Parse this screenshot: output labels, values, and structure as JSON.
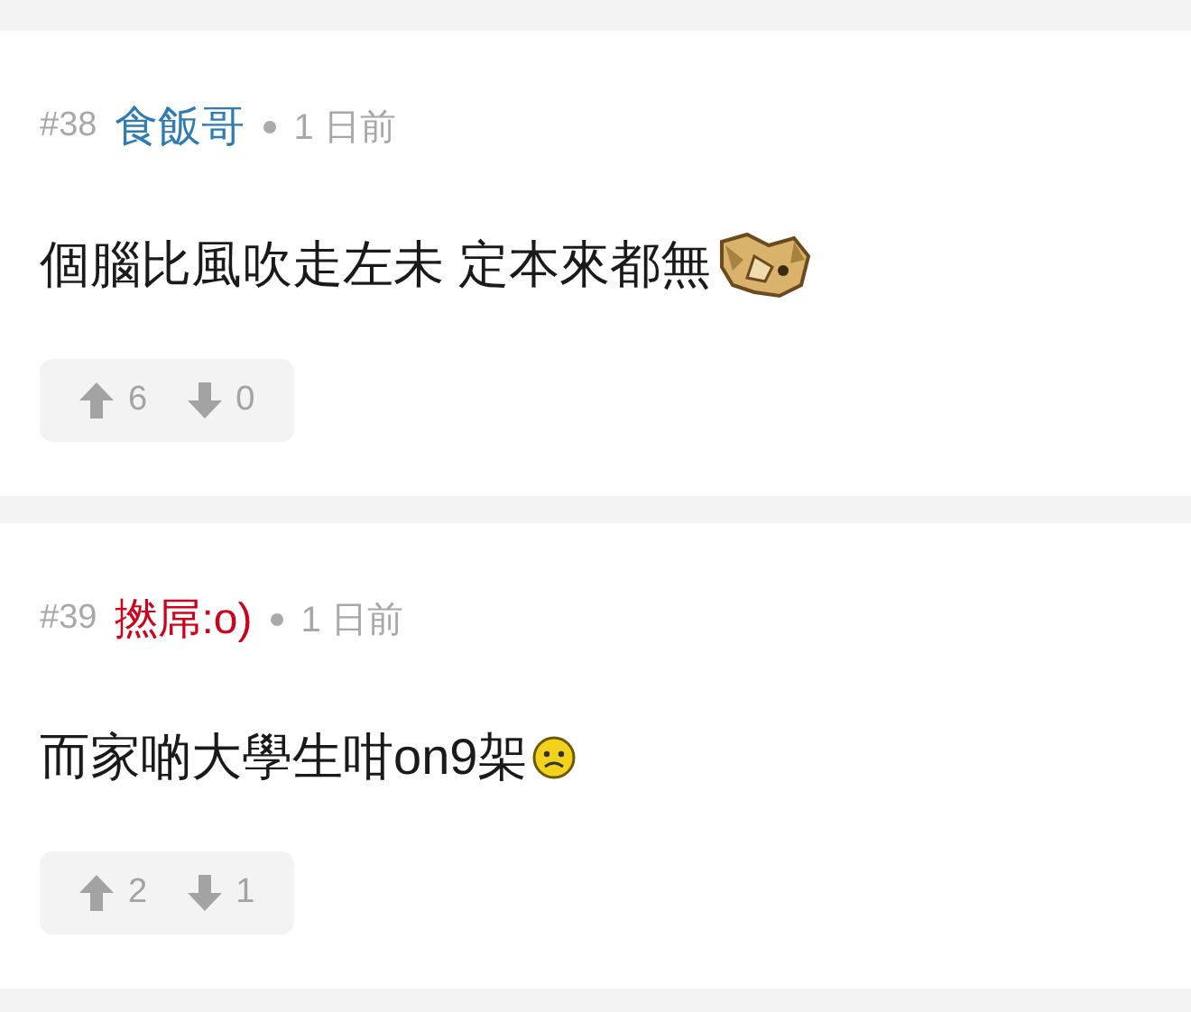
{
  "posts": [
    {
      "number": "#38",
      "author": "食飯哥",
      "color": "#2f7bb2",
      "time": "1 日前",
      "body": "個腦比風吹走左未 定本來都無",
      "kind": "dog",
      "upvotes": "6",
      "downvotes": "0"
    },
    {
      "number": "#39",
      "author": "撚屌:o)",
      "color": "#d0021b",
      "time": "1 日前",
      "body": "而家啲大學生咁on9架",
      "kind": "sad",
      "upvotes": "2",
      "downvotes": "1"
    }
  ]
}
